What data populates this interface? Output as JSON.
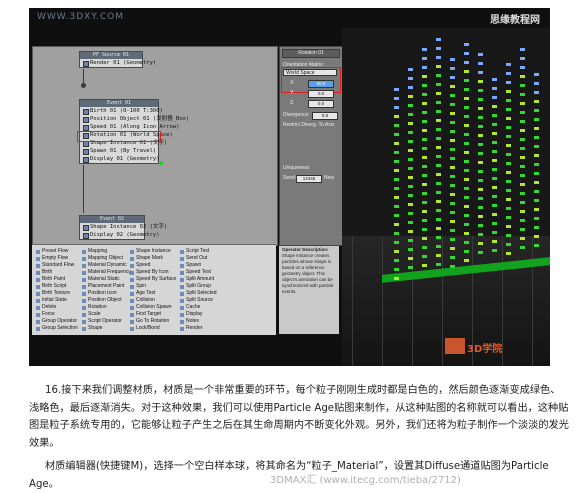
{
  "screenshot": {
    "watermark_top": "WWW.3DXY.COM",
    "logo_top": "思缘教程网",
    "node_graph": {
      "event_top_header": "PF Source 01",
      "event_top_rows": [
        "Render 01 (Geometry)"
      ],
      "event_mid_header": "Event 01",
      "event_mid_rows": [
        "Birth 01 (0-100 T:300)",
        "Position Object 01 (发射器_Box)",
        "Speed 01 (Along Icon Arrow)",
        "Rotation 01 (World Space)",
        "Shape Instance 01 (文字)",
        "Spawn 01 (By Travel)",
        "Display 01 (Geometry)"
      ],
      "event_bottom_header": "Event 02",
      "event_bottom_rows": [
        "Shape Instance 02 (文字)",
        "Display 02 (Geometry)"
      ]
    },
    "operators": {
      "col1": [
        "Preset Flow",
        "Empty Flow",
        "Standard Flow",
        "Birth",
        "Birth Paint",
        "Birth Script",
        "Birth Texture",
        "Initial State",
        "Delete",
        "Force",
        "Group Operator",
        "Group Selection",
        "Keep Apart"
      ],
      "col2": [
        "Mapping",
        "Mapping Object",
        "Material Dynamic",
        "Material Frequency",
        "Material Static",
        "Placement Paint",
        "Position Icon",
        "Position Object",
        "Rotation",
        "Scale",
        "Script Operator",
        "Shape",
        "Shape Facing"
      ],
      "col3": [
        "Shape Instance",
        "Shape Mark",
        "Speed",
        "Speed By Icon",
        "Speed By Surface",
        "Spin",
        "Age Test",
        "Collision",
        "Collision Spawn",
        "Find Target",
        "Go To Rotation",
        "Lock/Bond",
        "Scale Test"
      ],
      "col4": [
        "Script Test",
        "Send Out",
        "Spawn",
        "Speed Test",
        "Split Amount",
        "Split Group",
        "Split Selected",
        "Split Source",
        "Cache",
        "Display",
        "Notes",
        "Render"
      ]
    },
    "description": {
      "title": "Operator Description:",
      "body": "Shape Instance creates particles whose shape is based on a reference geometry object. This object's animation can be synchronized with particle events."
    },
    "panel": {
      "rollout_title": "Rotation 01",
      "sub_rollout": "Rotation",
      "orientation_label": "Orientation Matrix:",
      "orientation_value": "World Space",
      "x_label": "X:",
      "x_value": "90.0",
      "y_label": "Y:",
      "y_value": "0.0",
      "z_label": "Z:",
      "z_value": "0.0",
      "divergence_label": "Divergence:",
      "divergence_value": "0.0",
      "restrict_label": "Restrict Diverg. To Axis",
      "uniqueness_label": "Uniqueness",
      "seed_label": "Seed:",
      "seed_value": "12345",
      "new_label": "New"
    },
    "stamp_label": "3D学院"
  },
  "article": {
    "paragraph1": "16.接下来我们调整材质，材质是一个非常重要的环节，每个粒子刚刚生成时都是白色的，然后颜色逐渐变成绿色、浅略色，最后逐渐消失。对于这种效果，我们可以使用Particle Age贴图来制作，从这种贴图的名称就可以看出，这种贴图是粒子系统专用的，它能够让粒子产生之后在其生命周期内不断变化外观。另外，我们还将为粒子制作一个淡淡的发光效果。",
    "paragraph2": "材质编辑器(快捷键M)，选择一个空白样本球，将其命名为“粒子_Material”，设置其Diffuse通道贴图为Particle Age。",
    "watermark_bottom": "3DMAX汇 (www.itecg.com/tieba/2712)"
  },
  "colors": {
    "particle_green": "#33d833",
    "particle_yellow": "#b4e62e",
    "particle_blue": "#7aa8ff",
    "highlight_red": "#e02020"
  }
}
